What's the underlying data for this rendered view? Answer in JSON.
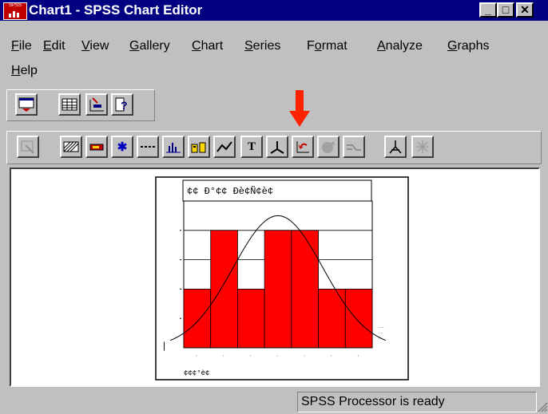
{
  "window": {
    "title": "Chart1 - SPSS Chart Editor",
    "icon_label": "SPSS",
    "buttons": [
      "minimize",
      "restore",
      "close"
    ]
  },
  "menu": [
    {
      "label": "File",
      "underline": "F",
      "rest": "ile"
    },
    {
      "label": "Edit",
      "underline": "E",
      "rest": "dit"
    },
    {
      "label": "View",
      "underline": "V",
      "rest": "iew"
    },
    {
      "label": "Gallery",
      "underline": "G",
      "rest": "allery"
    },
    {
      "label": "Chart",
      "underline": "C",
      "rest": "hart"
    },
    {
      "label": "Series",
      "underline": "S",
      "rest": "eries"
    },
    {
      "label": "Format",
      "pre": "F",
      "underline": "o",
      "rest": "rmat"
    },
    {
      "label": "Analyze",
      "underline": "A",
      "rest": "nalyze"
    },
    {
      "label": "Graphs",
      "underline": "G",
      "rest": "raphs"
    },
    {
      "label": "Help",
      "underline": "H",
      "rest": "elp"
    }
  ],
  "toolbar1": [
    "chart-window-icon",
    "data-editor-icon",
    "goto-case-icon",
    "help-icon"
  ],
  "toolbar2": [
    "point-select-icon",
    "fill-pattern-icon",
    "color-icon",
    "marker-icon",
    "line-style-icon",
    "bar-style-icon",
    "bar-label-icon",
    "interpolation-icon",
    "text-icon",
    "axis-icon",
    "swap-axes-icon",
    "explode-slice-icon",
    "break-line-icon",
    "spin-icon",
    "3d-rotation-icon"
  ],
  "chart": {
    "header_text": "¢¢ Ð°¢¢ Ðè¢Ñ¢è¢",
    "bar_color": "#ff0000",
    "legend_text": [
      "····",
      "···",
      "··"
    ],
    "x_axis_text": "¢¢¢°è¢"
  },
  "chart_data": {
    "type": "bar",
    "title": "",
    "series": [
      {
        "values": [
          1,
          2,
          1,
          2,
          2,
          1,
          1
        ]
      }
    ],
    "overlay": "normal-curve",
    "ylim": [
      0,
      2.5
    ],
    "grid": true
  },
  "status": {
    "text": "SPSS Processor  is ready"
  },
  "annotation": {
    "arrow_color": "#ff2200"
  }
}
